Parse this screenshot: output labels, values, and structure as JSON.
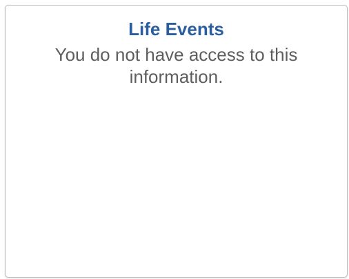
{
  "tile": {
    "title": "Life Events",
    "message": "You do not have access to this information."
  },
  "colors": {
    "title": "#2a5e9e",
    "message": "#5e5e5e",
    "border": "#b9b9b9"
  }
}
